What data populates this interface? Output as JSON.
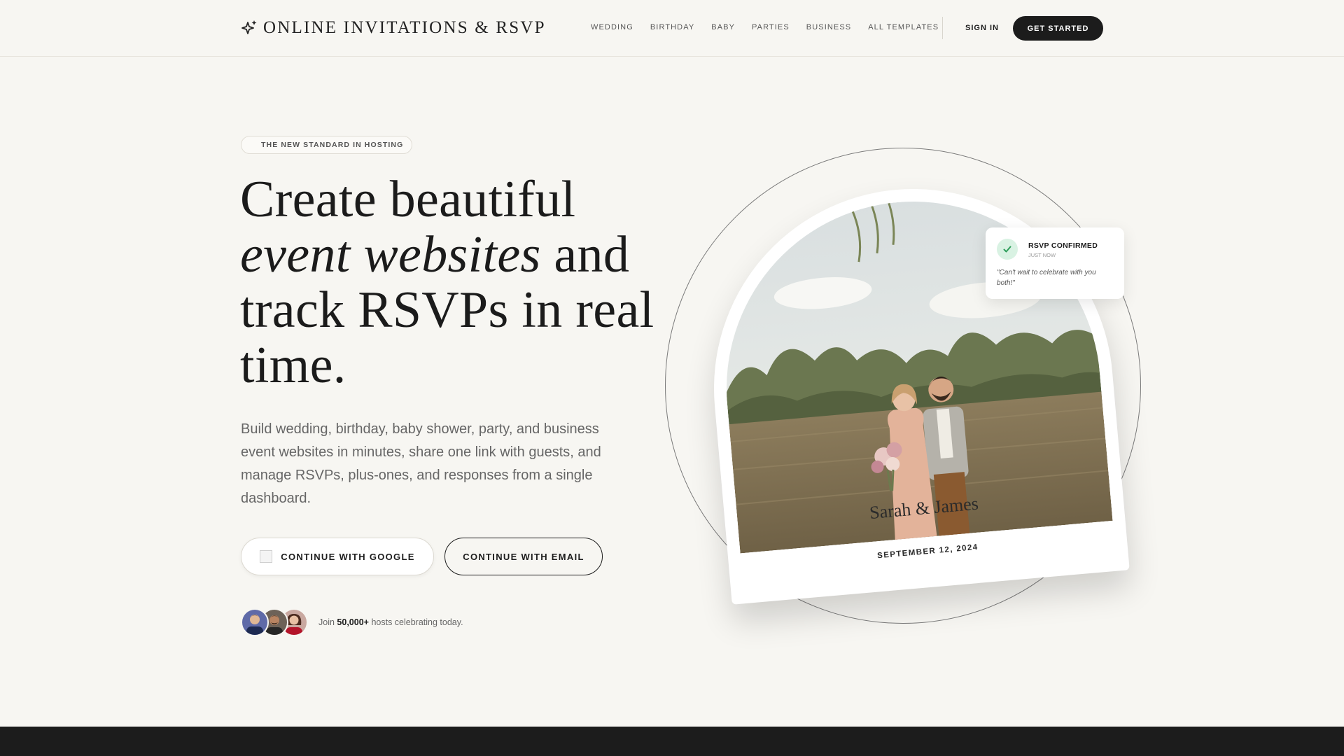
{
  "brand": {
    "name": "ONLINE INVITATIONS & RSVP"
  },
  "nav": {
    "items": [
      {
        "label": "WEDDING"
      },
      {
        "label": "BIRTHDAY"
      },
      {
        "label": "BABY"
      },
      {
        "label": "PARTIES"
      },
      {
        "label": "BUSINESS"
      },
      {
        "label": "ALL TEMPLATES"
      }
    ],
    "sign_in": "SIGN IN",
    "get_started": "GET STARTED"
  },
  "hero": {
    "badge": "THE NEW STANDARD IN HOSTING",
    "headline_part1": "Create beautiful",
    "headline_em": "event websites",
    "headline_part2": "and track RSVPs in real time.",
    "subtext": "Build wedding, birthday, baby shower, party, and business event websites in minutes, share one link with guests, and manage RSVPs, plus-ones, and responses from a single dashboard.",
    "google_button": "CONTINUE WITH GOOGLE",
    "email_button": "CONTINUE WITH EMAIL",
    "social_proof": {
      "prefix": "Join",
      "count": "50,000+",
      "suffix": "hosts celebrating today."
    }
  },
  "showcase": {
    "couple_names": "Sarah & James",
    "date": "SEPTEMBER 12, 2024"
  },
  "rsvp_card": {
    "title": "RSVP CONFIRMED",
    "time": "JUST NOW",
    "quote": "\"Can't wait to celebrate with you both!\""
  },
  "colors": {
    "background": "#f7f6f2",
    "primary_button": "#1c1c1c",
    "success": "#2e9e5b"
  }
}
